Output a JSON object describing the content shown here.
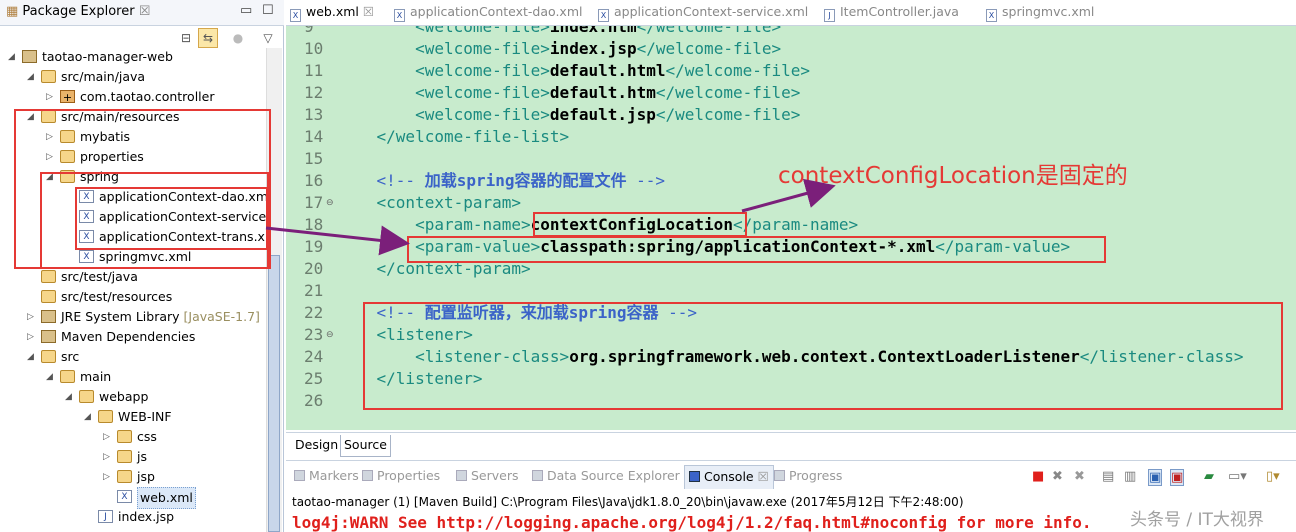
{
  "package_explorer": {
    "title": "Package Explorer",
    "close": "☒",
    "tree": [
      {
        "label": "taotao-manager-web",
        "level": 0,
        "arrow": "◢",
        "icon": "project-icon"
      },
      {
        "label": "src/main/java",
        "level": 1,
        "arrow": "◢",
        "icon": "source-folder-icon"
      },
      {
        "label": "com.taotao.controller",
        "level": 2,
        "arrow": "▷",
        "icon": "package-icon"
      },
      {
        "label": "src/main/resources",
        "level": 1,
        "arrow": "◢",
        "icon": "source-folder-icon"
      },
      {
        "label": "mybatis",
        "level": 2,
        "arrow": "▷",
        "icon": "folder-icon"
      },
      {
        "label": "properties",
        "level": 2,
        "arrow": "▷",
        "icon": "folder-icon"
      },
      {
        "label": "spring",
        "level": 2,
        "arrow": "◢",
        "icon": "folder-icon"
      },
      {
        "label": "applicationContext-dao.xml",
        "level": 3,
        "arrow": "",
        "icon": "xml-file-icon"
      },
      {
        "label": "applicationContext-service.x",
        "level": 3,
        "arrow": "",
        "icon": "xml-file-icon"
      },
      {
        "label": "applicationContext-trans.xm",
        "level": 3,
        "arrow": "",
        "icon": "xml-file-icon"
      },
      {
        "label": "springmvc.xml",
        "level": 3,
        "arrow": "",
        "icon": "xml-file-icon"
      },
      {
        "label": "src/test/java",
        "level": 1,
        "arrow": "",
        "icon": "source-folder-icon"
      },
      {
        "label": "src/test/resources",
        "level": 1,
        "arrow": "",
        "icon": "source-folder-icon"
      },
      {
        "label": "JRE System Library",
        "deco": "[JavaSE-1.7]",
        "level": 1,
        "arrow": "▷",
        "icon": "library-icon"
      },
      {
        "label": "Maven Dependencies",
        "level": 1,
        "arrow": "▷",
        "icon": "library-icon"
      },
      {
        "label": "src",
        "level": 1,
        "arrow": "◢",
        "icon": "folder-icon"
      },
      {
        "label": "main",
        "level": 2,
        "arrow": "◢",
        "icon": "folder-icon"
      },
      {
        "label": "webapp",
        "level": 3,
        "arrow": "◢",
        "icon": "folder-icon"
      },
      {
        "label": "WEB-INF",
        "level": 4,
        "arrow": "◢",
        "icon": "folder-icon"
      },
      {
        "label": "css",
        "level": 5,
        "arrow": "▷",
        "icon": "folder-icon"
      },
      {
        "label": "js",
        "level": 5,
        "arrow": "▷",
        "icon": "folder-icon"
      },
      {
        "label": "jsp",
        "level": 5,
        "arrow": "▷",
        "icon": "folder-icon"
      },
      {
        "label": "web.xml",
        "level": 5,
        "arrow": "",
        "icon": "xml-file-icon",
        "selected": true
      },
      {
        "label": "index.jsp",
        "level": 4,
        "arrow": "",
        "icon": "jsp-file-icon"
      }
    ]
  },
  "editor": {
    "tabs": [
      {
        "label": "web.xml",
        "active": true,
        "close": "☒"
      },
      {
        "label": "applicationContext-dao.xml"
      },
      {
        "label": "applicationContext-service.xml"
      },
      {
        "label": "ItemController.java"
      },
      {
        "label": "springmvc.xml"
      }
    ],
    "lines": [
      {
        "n": "9",
        "ind": "        ",
        "t": "<welcome-file>",
        "v": "index.htm",
        "e": "</welcome-file>"
      },
      {
        "n": "10",
        "ind": "        ",
        "t": "<welcome-file>",
        "v": "index.jsp",
        "e": "</welcome-file>"
      },
      {
        "n": "11",
        "ind": "        ",
        "t": "<welcome-file>",
        "v": "default.html",
        "e": "</welcome-file>"
      },
      {
        "n": "12",
        "ind": "        ",
        "t": "<welcome-file>",
        "v": "default.htm",
        "e": "</welcome-file>"
      },
      {
        "n": "13",
        "ind": "        ",
        "t": "<welcome-file>",
        "v": "default.jsp",
        "e": "</welcome-file>"
      },
      {
        "n": "14",
        "ind": "    ",
        "t": "</welcome-file-list>",
        "v": "",
        "e": ""
      },
      {
        "n": "15",
        "ind": "",
        "t": "",
        "v": "",
        "e": ""
      },
      {
        "n": "16",
        "ind": "    ",
        "c1": "<!-- ",
        "c2": "加载spring容器的配置文件",
        "c3": " -->"
      },
      {
        "n": "17",
        "ind": "    ",
        "t": "<context-param>",
        "v": "",
        "e": "",
        "fold": true
      },
      {
        "n": "18",
        "ind": "        ",
        "t": "<param-name>",
        "v": "contextConfigLocation",
        "e": "</param-name>"
      },
      {
        "n": "19",
        "ind": "        ",
        "t": "<param-value>",
        "v": "classpath:spring/applicationContext-*.xml",
        "e": "</param-value>"
      },
      {
        "n": "20",
        "ind": "    ",
        "t": "</context-param>",
        "v": "",
        "e": ""
      },
      {
        "n": "21",
        "ind": "",
        "t": "",
        "v": "",
        "e": ""
      },
      {
        "n": "22",
        "ind": "    ",
        "c1": "<!-- ",
        "c2": "配置监听器，来加载spring容器",
        "c3": " -->"
      },
      {
        "n": "23",
        "ind": "    ",
        "t": "<listener>",
        "v": "",
        "e": "",
        "fold": true
      },
      {
        "n": "24",
        "ind": "        ",
        "t": "<listener-class>",
        "v": "org.springframework.web.context.ContextLoaderListener",
        "e": "</listener-class>"
      },
      {
        "n": "25",
        "ind": "    ",
        "t": "</listener>",
        "v": "",
        "e": ""
      },
      {
        "n": "26",
        "ind": "",
        "t": "",
        "v": "",
        "e": ""
      }
    ],
    "bottom_tabs": [
      "Design",
      "Source"
    ],
    "annotation": "contextConfigLocation是固定的"
  },
  "console": {
    "tabs": [
      {
        "label": "Markers"
      },
      {
        "label": "Properties"
      },
      {
        "label": "Servers"
      },
      {
        "label": "Data Source Explorer"
      },
      {
        "label": "Console",
        "active": true,
        "close": "☒"
      },
      {
        "label": "Progress"
      }
    ],
    "launch": "taotao-manager (1) [Maven Build] C:\\Program Files\\Java\\jdk1.8.0_20\\bin\\javaw.exe (2017年5月12日 下午2:48:00)",
    "output": "log4j:WARN See http://logging.apache.org/log4j/1.2/faq.html#noconfig for more info.",
    "watermark": "头条号 / IT大视界"
  },
  "colors": {
    "code_bg": "#c8ebcd",
    "tag": "#1a8a80",
    "comment": "#3b63c8",
    "highlight": "#e53935",
    "arrow": "#7b1f7a"
  }
}
